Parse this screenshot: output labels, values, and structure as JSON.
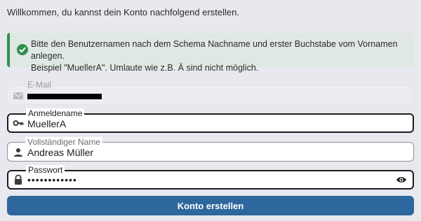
{
  "intro_text": "Willkommen, du kannst dein Konto nachfolgend erstellen.",
  "alert": {
    "icon": "check-circle-icon",
    "color": "#2f8f4e",
    "line1": "Bitte den Benutzernamen nach dem Schema Nachname und erster Buchstabe vom Vornamen anlegen.",
    "line2": "Beispiel \"MuellerA\". Umlaute wie z.B. Ä sind nicht möglich."
  },
  "form": {
    "email": {
      "label": "E-Mail",
      "icon": "envelope-icon",
      "disabled": true,
      "redacted": true
    },
    "username": {
      "label": "Anmeldename",
      "value": "MuellerA",
      "icon": "key-icon"
    },
    "fullname": {
      "label": "Vollständiger Name",
      "value": "Andreas Müller",
      "icon": "person-icon"
    },
    "password": {
      "label": "Passwort",
      "value": "••••••••••••",
      "icon": "lock-icon",
      "reveal_icon": "eye-icon"
    }
  },
  "submit_label": "Konto erstellen",
  "colors": {
    "primary": "#2e679d",
    "success": "#2f8f4e",
    "background": "#e8e9ee"
  }
}
